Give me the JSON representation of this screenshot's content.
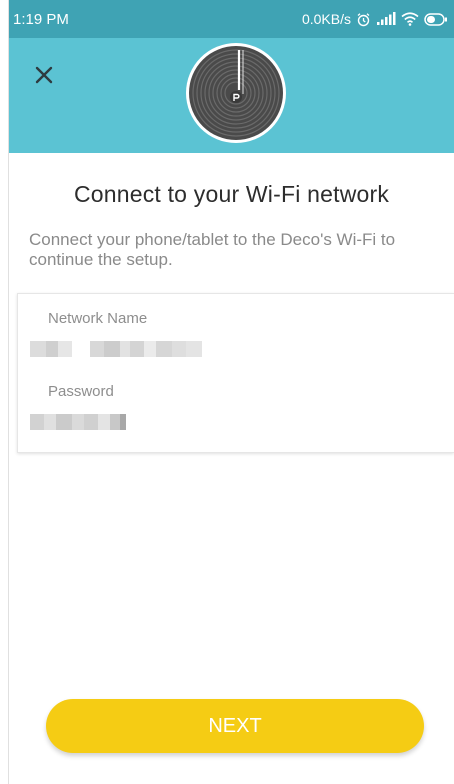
{
  "status_bar": {
    "time": "1:19 PM",
    "net_speed": "0.0KB/s",
    "icons": [
      "alarm-icon",
      "signal-icon",
      "wifi-icon",
      "battery-icon"
    ]
  },
  "header": {
    "close_icon": "close-icon",
    "device_icon": "deco-device-icon",
    "background_color": "#5bc3d3"
  },
  "main": {
    "title": "Connect to your Wi-Fi network",
    "subtitle": "Connect your phone/tablet to the Deco's Wi-Fi to continue the setup."
  },
  "wifi_card": {
    "network_name_label": "Network Name",
    "password_label": "Password"
  },
  "actions": {
    "next_label": "NEXT",
    "accent_color": "#f5cc14"
  }
}
